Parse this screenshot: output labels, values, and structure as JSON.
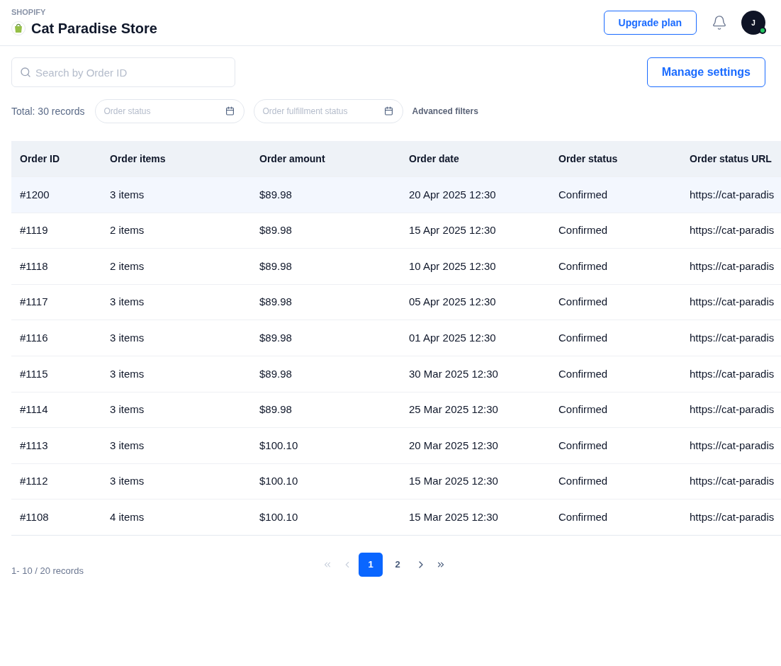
{
  "header": {
    "platform": "SHOPIFY",
    "store_name": "Cat Paradise Store",
    "upgrade_button": "Upgrade plan",
    "avatar_initial": "J",
    "online": true
  },
  "search": {
    "placeholder": "Search by Order ID"
  },
  "manage_button": "Manage settings",
  "filters": {
    "total": "Total: 30 records",
    "order_status": {
      "placeholder": "Order status"
    },
    "fulfillment_status": {
      "placeholder": "Order fulfillment status"
    },
    "advanced": "Advanced filters"
  },
  "table": {
    "columns": [
      "Order ID",
      "Order items",
      "Order amount",
      "Order date",
      "Order status",
      "Order status URL"
    ],
    "rows": [
      {
        "selected": true,
        "cells": [
          "#1200",
          "3 items",
          "$89.98",
          "20 Apr 2025 12:30",
          "Confirmed",
          "https://cat-paradis"
        ]
      },
      {
        "selected": false,
        "cells": [
          "#1119",
          "2 items",
          "$89.98",
          "15 Apr 2025 12:30",
          "Confirmed",
          "https://cat-paradis"
        ]
      },
      {
        "selected": false,
        "cells": [
          "#1118",
          "2 items",
          "$89.98",
          "10 Apr 2025 12:30",
          "Confirmed",
          "https://cat-paradis"
        ]
      },
      {
        "selected": false,
        "cells": [
          "#1117",
          "3 items",
          "$89.98",
          "05 Apr 2025 12:30",
          "Confirmed",
          "https://cat-paradis"
        ]
      },
      {
        "selected": false,
        "cells": [
          "#1116",
          "3 items",
          "$89.98",
          "01 Apr 2025 12:30",
          "Confirmed",
          "https://cat-paradis"
        ]
      },
      {
        "selected": false,
        "cells": [
          "#1115",
          "3 items",
          "$89.98",
          "30 Mar 2025 12:30",
          "Confirmed",
          "https://cat-paradis"
        ]
      },
      {
        "selected": false,
        "cells": [
          "#1114",
          "3 items",
          "$89.98",
          "25 Mar 2025 12:30",
          "Confirmed",
          "https://cat-paradis"
        ]
      },
      {
        "selected": false,
        "cells": [
          "#1113",
          "3 items",
          "$100.10",
          "20 Mar 2025 12:30",
          "Confirmed",
          "https://cat-paradis"
        ]
      },
      {
        "selected": false,
        "cells": [
          "#1112",
          "3 items",
          "$100.10",
          "15 Mar 2025 12:30",
          "Confirmed",
          "https://cat-paradis"
        ]
      },
      {
        "selected": false,
        "cells": [
          "#1108",
          "4 items",
          "$100.10",
          "15 Mar 2025 12:30",
          "Confirmed",
          "https://cat-paradis"
        ]
      }
    ]
  },
  "pagination": {
    "summary": "1- 10 / 20 records",
    "first_disabled": true,
    "prev_disabled": true,
    "next_disabled": false,
    "last_disabled": false,
    "pages": [
      {
        "label": "1",
        "selected": true
      },
      {
        "label": "2",
        "selected": false
      }
    ]
  }
}
